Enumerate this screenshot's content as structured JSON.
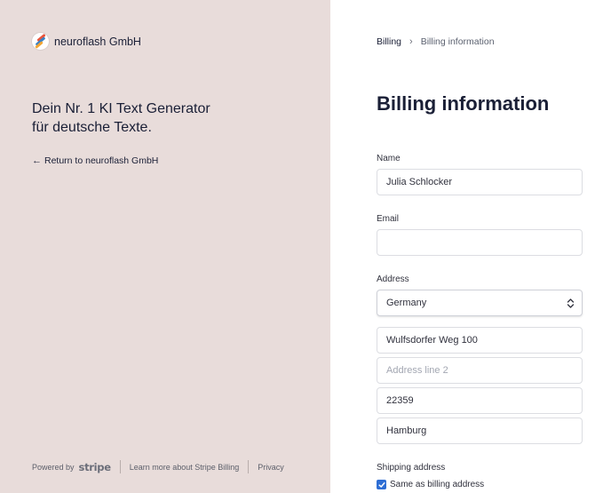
{
  "left": {
    "brand_name": "neuroflash GmbH",
    "tagline_line1": "Dein Nr. 1 KI Text Generator",
    "tagline_line2": "für deutsche Texte.",
    "return_label": "Return to neuroflash GmbH",
    "footer": {
      "powered_by": "Powered by",
      "stripe": "stripe",
      "learn_more": "Learn more about Stripe Billing",
      "privacy": "Privacy"
    }
  },
  "right": {
    "breadcrumb": [
      "Billing",
      "Billing information"
    ],
    "title": "Billing information",
    "name_label": "Name",
    "name_value": "Julia Schlocker",
    "email_label": "Email",
    "email_value": "",
    "address_label": "Address",
    "country_value": "Germany",
    "address_line1": "Wulfsdorfer Weg 100",
    "address_line2_placeholder": "Address line 2",
    "postal_code": "22359",
    "city": "Hamburg",
    "shipping_label": "Shipping address",
    "same_as_billing": "Same as billing address",
    "same_as_billing_checked": true
  },
  "colors": {
    "left_panel_bg": "#e8dcda",
    "checkbox_accent": "#2e6ed4",
    "text_primary": "#1a1f36"
  }
}
